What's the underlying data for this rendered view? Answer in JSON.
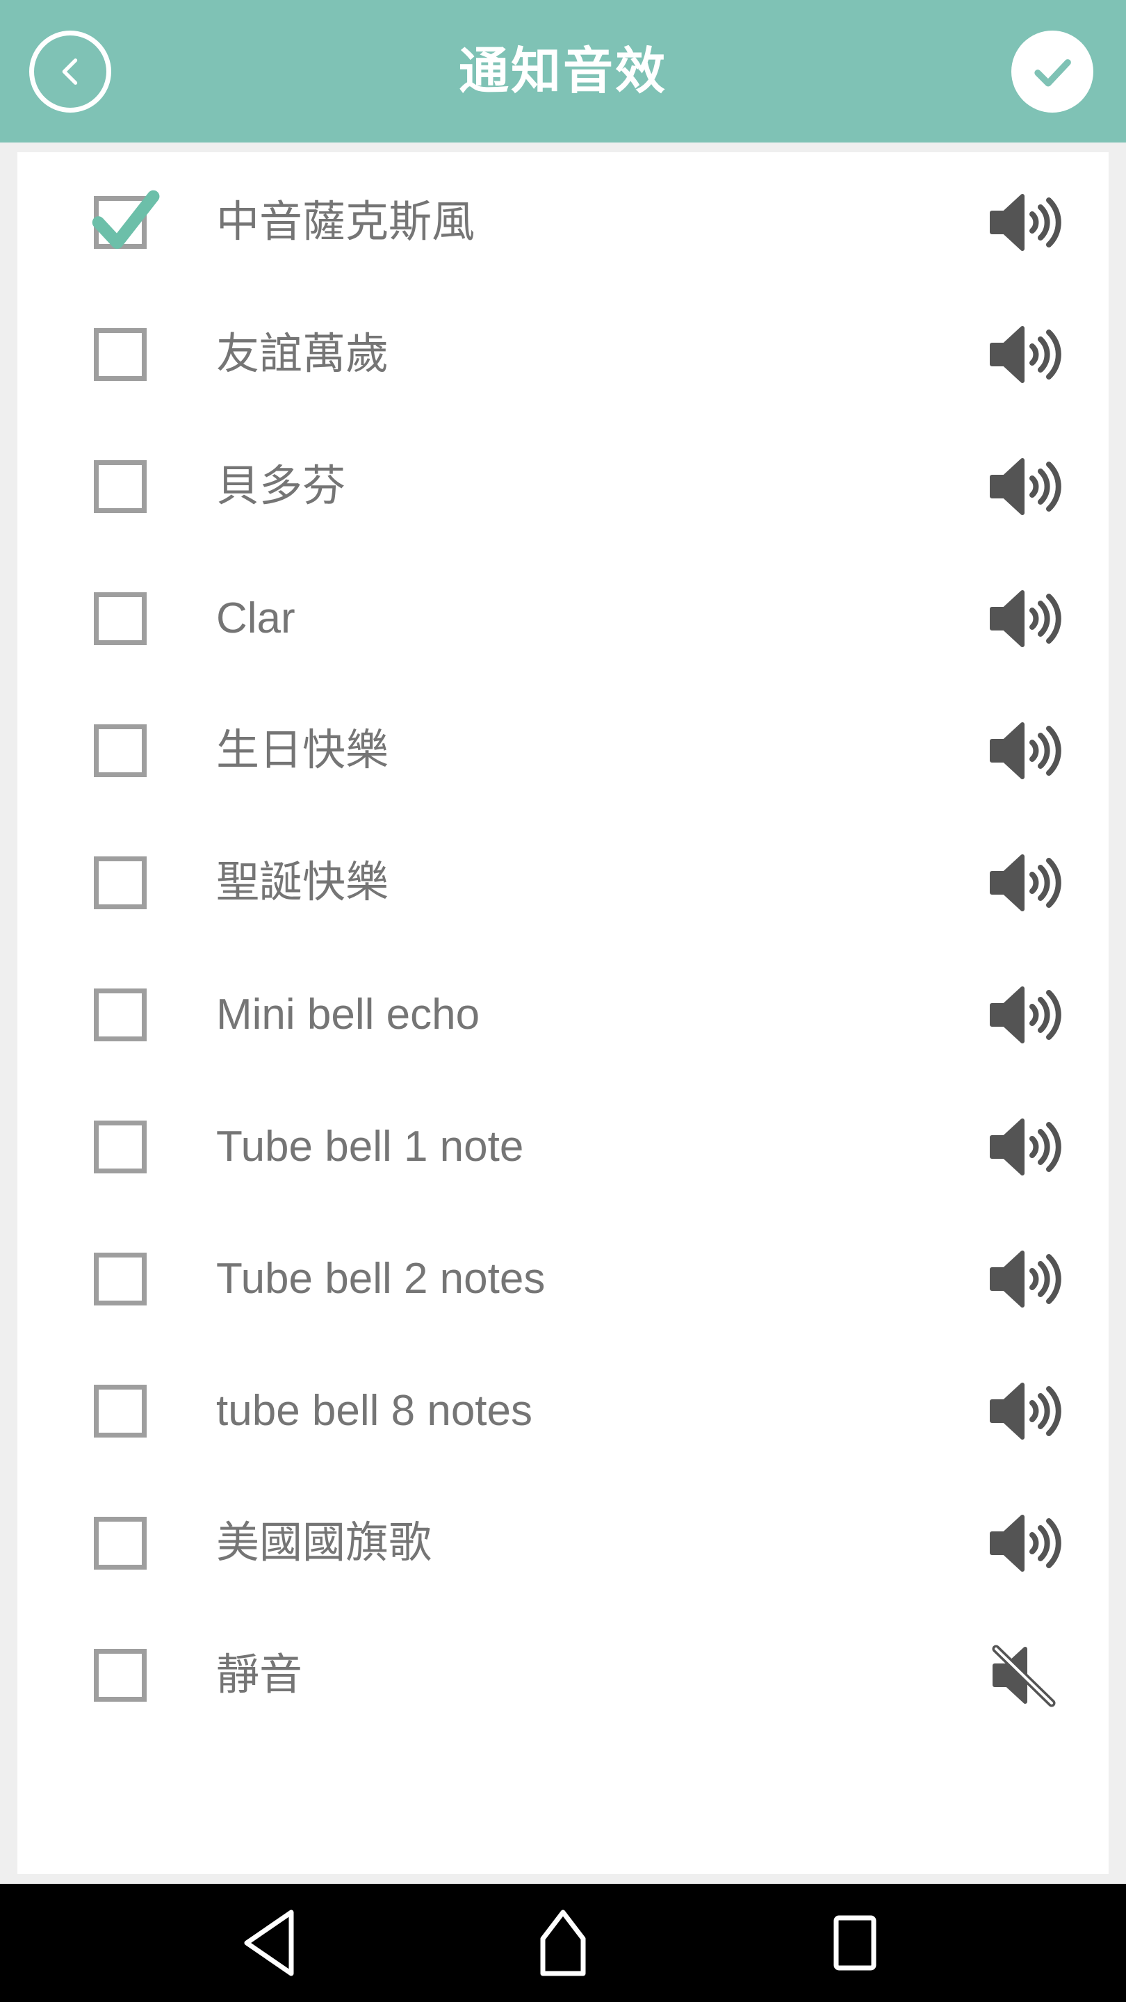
{
  "header": {
    "title": "通知音效",
    "back_icon": "chevron-left-icon",
    "confirm_icon": "check-circle-icon",
    "background_color": "#7fc2b5",
    "text_color": "#ffffff"
  },
  "theme": {
    "accent_green": "#7fc2b5",
    "check_green": "#6cbfa9",
    "page_background": "#efefef",
    "card_background": "#ffffff",
    "label_color": "#757575",
    "checkbox_border": "#9e9e9e",
    "speaker_icon_color": "#545454",
    "navbar_background": "#000000"
  },
  "list": {
    "items": [
      {
        "label": "中音薩克斯風",
        "checked": true,
        "icon": "speaker-on-icon"
      },
      {
        "label": "友誼萬歲",
        "checked": false,
        "icon": "speaker-on-icon"
      },
      {
        "label": "貝多芬",
        "checked": false,
        "icon": "speaker-on-icon"
      },
      {
        "label": "Clar",
        "checked": false,
        "icon": "speaker-on-icon"
      },
      {
        "label": "生日快樂",
        "checked": false,
        "icon": "speaker-on-icon"
      },
      {
        "label": "聖誕快樂",
        "checked": false,
        "icon": "speaker-on-icon"
      },
      {
        "label": "Mini bell echo",
        "checked": false,
        "icon": "speaker-on-icon"
      },
      {
        "label": "Tube bell 1 note",
        "checked": false,
        "icon": "speaker-on-icon"
      },
      {
        "label": "Tube bell 2 notes",
        "checked": false,
        "icon": "speaker-on-icon"
      },
      {
        "label": "tube bell 8 notes",
        "checked": false,
        "icon": "speaker-on-icon"
      },
      {
        "label": "美國國旗歌",
        "checked": false,
        "icon": "speaker-on-icon"
      },
      {
        "label": "靜音",
        "checked": false,
        "icon": "speaker-mute-icon"
      }
    ]
  },
  "navbar": {
    "buttons": [
      {
        "name": "back",
        "icon": "triangle-back-icon"
      },
      {
        "name": "home",
        "icon": "home-icon"
      },
      {
        "name": "recents",
        "icon": "square-recents-icon"
      }
    ]
  }
}
